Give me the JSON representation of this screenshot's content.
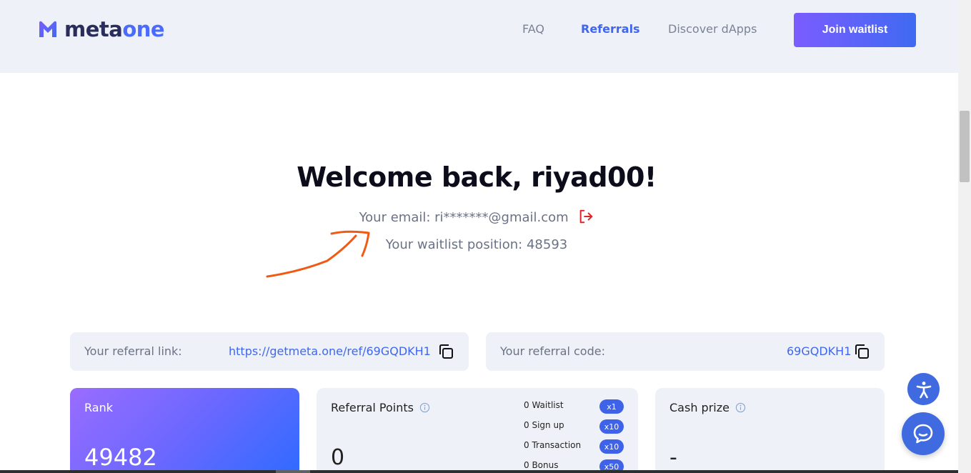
{
  "header": {
    "logo": {
      "text_main": "meta",
      "text_accent": "one"
    },
    "nav": [
      {
        "label": "FAQ",
        "active": false
      },
      {
        "label": "Referrals",
        "active": true
      },
      {
        "label": "Discover dApps",
        "active": false
      }
    ],
    "join_label": "Join waitlist"
  },
  "welcome": {
    "title": "Welcome back, riyad00!",
    "email_text": "Your email: ri*******@gmail.com",
    "position_text": "Your waitlist position: 48593"
  },
  "referral": {
    "link_label": "Your referral link:",
    "link_value": "https://getmeta.one/ref/69GQDKH1",
    "code_label": "Your referral code:",
    "code_value": "69GQDKH1"
  },
  "cards": {
    "rank": {
      "title": "Rank",
      "value": "49482"
    },
    "points": {
      "title": "Referral Points",
      "value": "0",
      "rows": [
        {
          "label": "0 Waitlist",
          "multiplier": "x1"
        },
        {
          "label": "0 Sign up",
          "multiplier": "x10"
        },
        {
          "label": "0 Transaction",
          "multiplier": "x10"
        },
        {
          "label": "0 Bonus",
          "multiplier": "x50"
        }
      ]
    },
    "cash": {
      "title": "Cash prize",
      "value": "-"
    }
  },
  "colors": {
    "accent": "#4066f0",
    "header_bg": "#eef2f8",
    "logout_red": "#e0262b",
    "annotation_orange": "#f05a14"
  },
  "icons": {
    "logout": "logout-icon",
    "copy": "copy-icon",
    "info": "info-icon",
    "accessibility": "accessibility-icon",
    "chat": "chat-icon"
  }
}
